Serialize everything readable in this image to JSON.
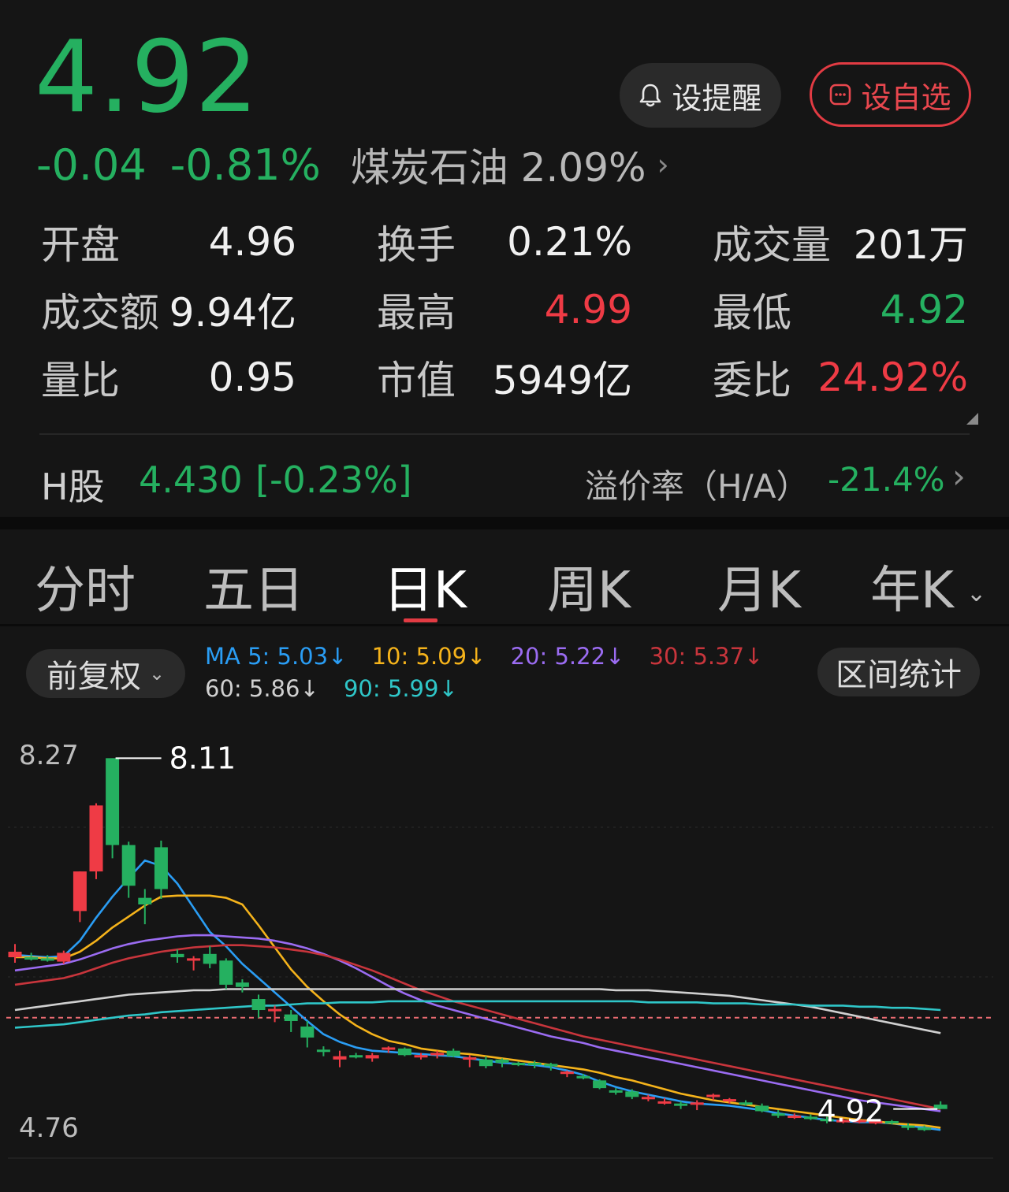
{
  "quote": {
    "price": "4.92",
    "change_abs": "-0.04",
    "change_pct": "-0.81%",
    "sector_name": "煤炭石油",
    "sector_pct": "2.09%",
    "alert_button": "设提醒",
    "watchlist_button": "设自选"
  },
  "stats": [
    [
      {
        "label": "开盘",
        "value": "4.96",
        "color": "#f0f0f0"
      },
      {
        "label": "换手",
        "value": "0.21%",
        "color": "#f0f0f0"
      },
      {
        "label": "成交量",
        "value": "201万",
        "color": "#f0f0f0"
      }
    ],
    [
      {
        "label": "成交额",
        "value": "9.94亿",
        "color": "#f0f0f0"
      },
      {
        "label": "最高",
        "value": "4.99",
        "color": "#ef3b45"
      },
      {
        "label": "最低",
        "value": "4.92",
        "color": "#25b060"
      }
    ],
    [
      {
        "label": "量比",
        "value": "0.95",
        "color": "#f0f0f0"
      },
      {
        "label": "市值",
        "value": "5949亿",
        "color": "#f0f0f0"
      },
      {
        "label": "委比",
        "value": "24.92%",
        "color": "#ef3b45"
      }
    ]
  ],
  "h_share": {
    "label": "H股",
    "price": "4.430",
    "change": "[-0.23%]",
    "premium_label": "溢价率（H/A）",
    "premium_value": "-21.4%"
  },
  "tabs": [
    {
      "label": "分时",
      "active": false
    },
    {
      "label": "五日",
      "active": false
    },
    {
      "label": "日K",
      "active": true
    },
    {
      "label": "周K",
      "active": false
    },
    {
      "label": "月K",
      "active": false
    },
    {
      "label": "年K",
      "active": false
    }
  ],
  "chart_controls": {
    "adjust_label": "前复权",
    "range_stats_label": "区间统计"
  },
  "moving_averages": [
    {
      "label": "MA 5: 5.03↓",
      "color": "#2a9df4"
    },
    {
      "label": "10: 5.09↓",
      "color": "#f5b31b"
    },
    {
      "label": "20: 5.22↓",
      "color": "#9b6cf2"
    },
    {
      "label": "30: 5.37↓",
      "color": "#c8353c"
    },
    {
      "label": "60: 5.86↓",
      "color": "#d0d0d0"
    },
    {
      "label": "90: 5.99↓",
      "color": "#2fc6c8"
    }
  ],
  "chart_data": {
    "type": "candlestick",
    "y_axis_labels": {
      "top": "8.27",
      "bottom": "4.76"
    },
    "ylim": [
      4.76,
      8.27
    ],
    "reference_price": 5.75,
    "max_marker": "8.11",
    "last_marker": "4.92",
    "up_color": "#ef3b45",
    "down_color": "#25b060",
    "candles": [
      [
        6.3,
        6.42,
        6.25,
        6.35
      ],
      [
        6.3,
        6.34,
        6.27,
        6.29
      ],
      [
        6.29,
        6.32,
        6.26,
        6.28
      ],
      [
        6.26,
        6.36,
        6.24,
        6.34
      ],
      [
        6.72,
        7.08,
        6.62,
        7.08
      ],
      [
        7.08,
        7.7,
        7.01,
        7.68
      ],
      [
        8.11,
        8.11,
        7.2,
        7.32
      ],
      [
        7.32,
        7.35,
        6.84,
        6.95
      ],
      [
        6.84,
        6.92,
        6.6,
        6.78
      ],
      [
        7.3,
        7.36,
        6.83,
        6.92
      ],
      [
        6.33,
        6.37,
        6.25,
        6.3
      ],
      [
        6.27,
        6.31,
        6.18,
        6.29
      ],
      [
        6.33,
        6.4,
        6.2,
        6.24
      ],
      [
        6.27,
        6.29,
        6.01,
        6.05
      ],
      [
        6.07,
        6.1,
        5.98,
        6.03
      ],
      [
        5.92,
        5.96,
        5.75,
        5.82
      ],
      [
        5.82,
        5.86,
        5.71,
        5.83
      ],
      [
        5.78,
        5.82,
        5.62,
        5.72
      ],
      [
        5.67,
        5.72,
        5.48,
        5.57
      ],
      [
        5.46,
        5.49,
        5.4,
        5.45
      ],
      [
        5.37,
        5.45,
        5.3,
        5.4
      ],
      [
        5.41,
        5.43,
        5.38,
        5.4
      ],
      [
        5.38,
        5.43,
        5.35,
        5.41
      ],
      [
        5.47,
        5.49,
        5.43,
        5.48
      ],
      [
        5.47,
        5.48,
        5.4,
        5.41
      ],
      [
        5.4,
        5.43,
        5.37,
        5.41
      ],
      [
        5.41,
        5.45,
        5.38,
        5.43
      ],
      [
        5.45,
        5.47,
        5.39,
        5.4
      ],
      [
        5.38,
        5.41,
        5.3,
        5.39
      ],
      [
        5.37,
        5.4,
        5.29,
        5.31
      ],
      [
        5.37,
        5.38,
        5.3,
        5.34
      ],
      [
        5.34,
        5.35,
        5.31,
        5.33
      ],
      [
        5.34,
        5.36,
        5.29,
        5.33
      ],
      [
        5.33,
        5.34,
        5.27,
        5.31
      ],
      [
        5.24,
        5.27,
        5.21,
        5.26
      ],
      [
        5.22,
        5.24,
        5.19,
        5.21
      ],
      [
        5.18,
        5.19,
        5.1,
        5.11
      ],
      [
        5.09,
        5.11,
        5.05,
        5.08
      ],
      [
        5.08,
        5.1,
        5.01,
        5.03
      ],
      [
        5.02,
        5.05,
        4.99,
        5.03
      ],
      [
        4.98,
        5.02,
        4.96,
        4.99
      ],
      [
        4.97,
        4.99,
        4.92,
        4.96
      ],
      [
        4.96,
        5.0,
        4.91,
        4.98
      ],
      [
        5.03,
        5.06,
        5.0,
        5.05
      ],
      [
        5.0,
        5.02,
        4.97,
        5.01
      ],
      [
        4.98,
        5.0,
        4.95,
        4.97
      ],
      [
        4.95,
        4.97,
        4.89,
        4.9
      ],
      [
        4.88,
        4.91,
        4.84,
        4.86
      ],
      [
        4.85,
        4.88,
        4.83,
        4.86
      ],
      [
        4.85,
        4.87,
        4.82,
        4.84
      ],
      [
        4.83,
        4.85,
        4.79,
        4.82
      ],
      [
        4.81,
        4.83,
        4.79,
        4.82
      ],
      [
        4.81,
        4.83,
        4.79,
        4.82
      ],
      [
        4.8,
        4.82,
        4.78,
        4.81
      ],
      [
        4.81,
        4.82,
        4.78,
        4.8
      ],
      [
        4.77,
        4.79,
        4.73,
        4.75
      ],
      [
        4.75,
        4.77,
        4.72,
        4.73
      ],
      [
        4.96,
        4.99,
        4.92,
        4.92
      ]
    ],
    "ma_series": [
      {
        "name": "MA5",
        "color": "#2a9df4",
        "values": [
          6.32,
          6.31,
          6.3,
          6.31,
          6.45,
          6.66,
          6.85,
          7.02,
          7.18,
          7.13,
          6.97,
          6.75,
          6.53,
          6.4,
          6.24,
          6.11,
          5.98,
          5.85,
          5.72,
          5.6,
          5.53,
          5.48,
          5.45,
          5.44,
          5.43,
          5.42,
          5.41,
          5.4,
          5.38,
          5.36,
          5.34,
          5.33,
          5.32,
          5.3,
          5.27,
          5.23,
          5.17,
          5.12,
          5.08,
          5.05,
          5.02,
          4.99,
          4.97,
          4.96,
          4.95,
          4.93,
          4.91,
          4.88,
          4.86,
          4.84,
          4.82,
          4.81,
          4.8,
          4.8,
          4.79,
          4.77,
          4.75,
          4.73
        ]
      },
      {
        "name": "MA10",
        "color": "#f5b31b",
        "values": [
          6.3,
          6.3,
          6.29,
          6.29,
          6.35,
          6.45,
          6.57,
          6.67,
          6.77,
          6.85,
          6.86,
          6.86,
          6.86,
          6.84,
          6.78,
          6.59,
          6.39,
          6.19,
          6.03,
          5.9,
          5.78,
          5.68,
          5.6,
          5.54,
          5.51,
          5.47,
          5.45,
          5.43,
          5.42,
          5.4,
          5.38,
          5.36,
          5.34,
          5.32,
          5.3,
          5.28,
          5.25,
          5.21,
          5.18,
          5.14,
          5.1,
          5.06,
          5.03,
          5.0,
          4.98,
          4.96,
          4.94,
          4.92,
          4.9,
          4.88,
          4.86,
          4.84,
          4.82,
          4.81,
          4.79,
          4.78,
          4.77,
          4.75
        ]
      },
      {
        "name": "MA20",
        "color": "#9b6cf2",
        "values": [
          6.18,
          6.2,
          6.22,
          6.24,
          6.28,
          6.33,
          6.38,
          6.42,
          6.45,
          6.47,
          6.49,
          6.5,
          6.5,
          6.49,
          6.48,
          6.47,
          6.45,
          6.42,
          6.38,
          6.33,
          6.27,
          6.2,
          6.12,
          6.04,
          5.97,
          5.91,
          5.86,
          5.82,
          5.78,
          5.74,
          5.7,
          5.66,
          5.62,
          5.58,
          5.55,
          5.52,
          5.48,
          5.45,
          5.42,
          5.39,
          5.36,
          5.33,
          5.3,
          5.27,
          5.24,
          5.21,
          5.18,
          5.15,
          5.12,
          5.09,
          5.06,
          5.03,
          5.0,
          4.98,
          4.96,
          4.94,
          4.92,
          4.9
        ]
      },
      {
        "name": "MA30",
        "color": "#c8353c",
        "values": [
          6.05,
          6.07,
          6.09,
          6.11,
          6.15,
          6.2,
          6.25,
          6.29,
          6.32,
          6.35,
          6.37,
          6.39,
          6.4,
          6.41,
          6.41,
          6.4,
          6.39,
          6.37,
          6.35,
          6.32,
          6.28,
          6.23,
          6.18,
          6.12,
          6.06,
          6.0,
          5.95,
          5.9,
          5.86,
          5.82,
          5.78,
          5.74,
          5.7,
          5.66,
          5.62,
          5.58,
          5.55,
          5.52,
          5.49,
          5.46,
          5.43,
          5.4,
          5.37,
          5.34,
          5.31,
          5.28,
          5.25,
          5.22,
          5.19,
          5.16,
          5.13,
          5.1,
          5.07,
          5.04,
          5.01,
          4.98,
          4.95,
          4.92
        ]
      },
      {
        "name": "MA60",
        "color": "#d0d0d0",
        "values": [
          5.82,
          5.84,
          5.86,
          5.88,
          5.9,
          5.92,
          5.94,
          5.96,
          5.97,
          5.98,
          5.99,
          6.0,
          6.0,
          6.01,
          6.01,
          6.01,
          6.01,
          6.01,
          6.01,
          6.01,
          6.01,
          6.01,
          6.01,
          6.01,
          6.01,
          6.01,
          6.01,
          6.01,
          6.01,
          6.01,
          6.01,
          6.01,
          6.01,
          6.01,
          6.01,
          6.01,
          6.01,
          6.0,
          6.0,
          6.0,
          5.99,
          5.98,
          5.97,
          5.96,
          5.95,
          5.93,
          5.91,
          5.89,
          5.87,
          5.85,
          5.82,
          5.79,
          5.76,
          5.73,
          5.7,
          5.67,
          5.64,
          5.61
        ]
      },
      {
        "name": "MA90",
        "color": "#2fc6c8",
        "values": [
          5.66,
          5.67,
          5.68,
          5.69,
          5.71,
          5.73,
          5.75,
          5.77,
          5.78,
          5.8,
          5.81,
          5.82,
          5.83,
          5.84,
          5.85,
          5.86,
          5.86,
          5.87,
          5.88,
          5.88,
          5.89,
          5.89,
          5.89,
          5.9,
          5.9,
          5.9,
          5.9,
          5.9,
          5.9,
          5.9,
          5.9,
          5.9,
          5.9,
          5.9,
          5.9,
          5.9,
          5.9,
          5.9,
          5.9,
          5.89,
          5.89,
          5.89,
          5.89,
          5.88,
          5.88,
          5.88,
          5.87,
          5.87,
          5.87,
          5.86,
          5.86,
          5.86,
          5.85,
          5.85,
          5.84,
          5.84,
          5.83,
          5.82
        ]
      }
    ]
  }
}
